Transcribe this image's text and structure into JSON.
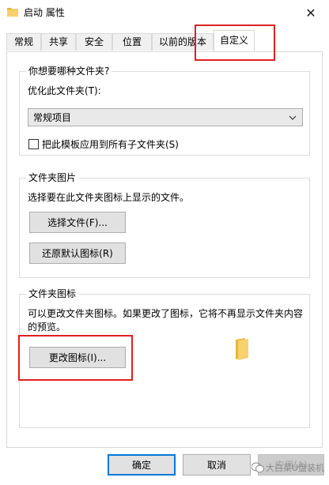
{
  "window": {
    "title": "启动 属性",
    "close_glyph": "✕"
  },
  "tabs": [
    {
      "label": "常规"
    },
    {
      "label": "共享"
    },
    {
      "label": "安全"
    },
    {
      "label": "位置"
    },
    {
      "label": "以前的版本"
    },
    {
      "label": "自定义"
    }
  ],
  "active_tab": "自定义",
  "folder_type": {
    "group_title": "你想要哪种文件夹?",
    "optimize_label": "优化此文件夹(T):",
    "optimize_value": "常规项目",
    "apply_checkbox_label": "把此模板应用到所有子文件夹(S)",
    "apply_checked": false
  },
  "folder_pictures": {
    "group_title": "文件夹图片",
    "description": "选择要在此文件夹图标上显示的文件。",
    "choose_file_button": "选择文件(F)...",
    "restore_default_button": "还原默认图标(R)"
  },
  "folder_icons": {
    "group_title": "文件夹图标",
    "description_line1": "可以更改文件夹图标。如果更改了图标，它将不再显示文件夹内容",
    "description_line2": "的预览。",
    "change_icon_button": "更改图标(I)..."
  },
  "footer": {
    "ok_button": "确定",
    "cancel_button": "取消",
    "apply_button": "应用(A)"
  },
  "watermark": {
    "text": "大白菜U盘装机"
  },
  "colors": {
    "highlight_red": "#e02020",
    "folder_yellow": "#f4c542",
    "default_button_border": "#0078d7"
  },
  "icons": {
    "title_icon": "folder-icon",
    "close_icon": "close-icon",
    "dropdown_icon": "chevron-down-icon",
    "preview_icon": "folder-icon",
    "watermark_icon": "wechat-icon"
  }
}
